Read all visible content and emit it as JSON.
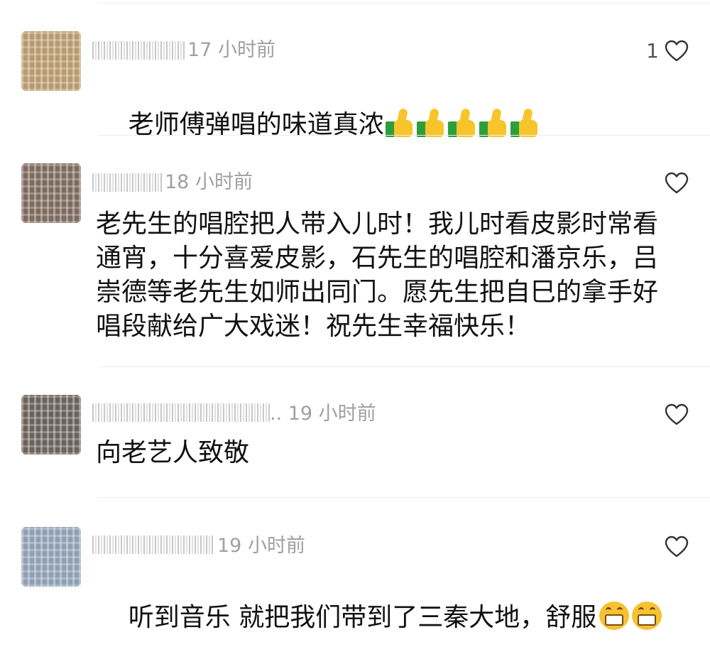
{
  "comments": [
    {
      "time": "17 小时前",
      "likes": "1",
      "text": "老师傅弹唱的味道真浓",
      "emoji": [
        "thumbs-up-icon",
        "thumbs-up-icon",
        "thumbs-up-icon",
        "thumbs-up-icon",
        "thumbs-up-icon"
      ],
      "avatar_color": "#b89a6e"
    },
    {
      "time": "18 小时前",
      "likes": "",
      "text": "老先生的唱腔把人带入儿时！我儿时看皮影时常看通宵，十分喜爱皮影，石先生的唱腔和潘京乐，吕崇德等老先生如师出同门。愿先生把自巳的拿手好唱段献给广大戏迷！祝先生幸福快乐！",
      "avatar_color": "#7e6a5e"
    },
    {
      "time": ".. 19 小时前",
      "likes": "",
      "text": "向老艺人致敬",
      "avatar_color": "#6b625a"
    },
    {
      "time": "19 小时前",
      "likes": "",
      "text": "听到音乐 就把我们带到了三秦大地，舒服",
      "emoji": [
        "grinning-face-icon",
        "grinning-face-icon"
      ],
      "avatar_color": "#8fa0b4"
    }
  ]
}
